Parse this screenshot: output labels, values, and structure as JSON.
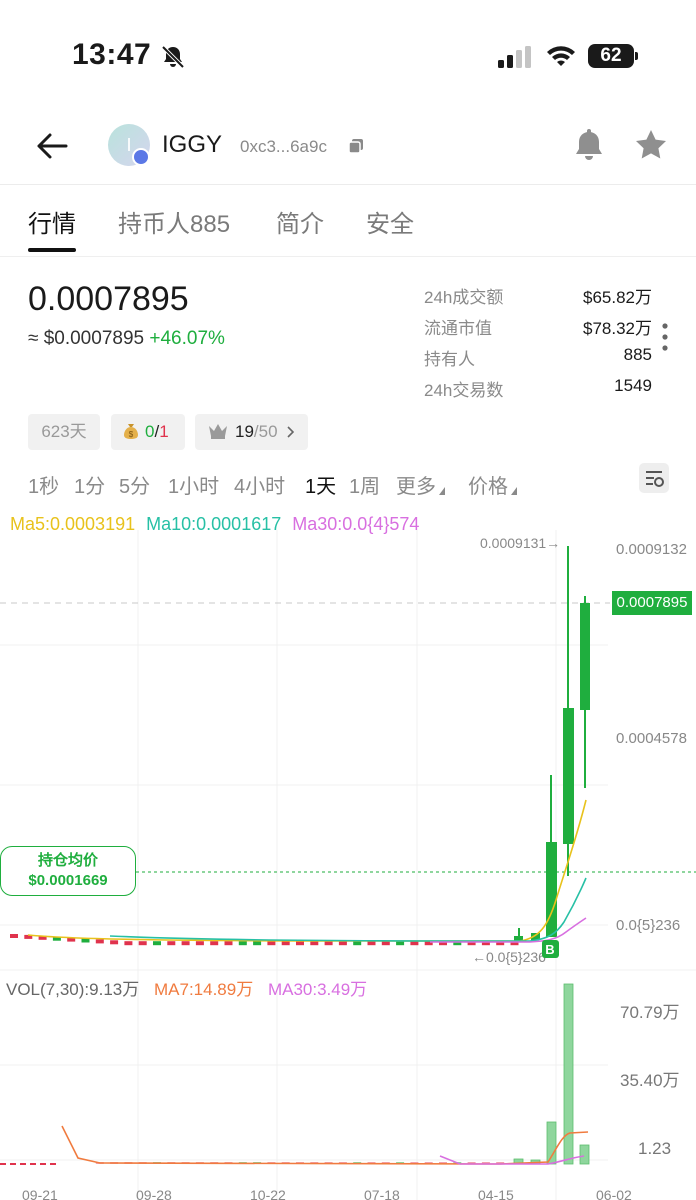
{
  "status_bar": {
    "time": "13:47",
    "battery": "62"
  },
  "header": {
    "token_symbol": "IGGY",
    "avatar_letter": "I",
    "address": "0xc3...6a9c"
  },
  "tabs": [
    {
      "label": "行情",
      "active": true
    },
    {
      "label": "持币人885",
      "active": false
    },
    {
      "label": "简介",
      "active": false
    },
    {
      "label": "安全",
      "active": false
    }
  ],
  "price": {
    "last": "0.0007895",
    "usd": "≈ $0.0007895",
    "change": "+46.07%"
  },
  "stats": [
    {
      "label": "24h成交额",
      "value": "$65.82万"
    },
    {
      "label": "流通市值",
      "value": "$78.32万"
    },
    {
      "label": "持有人",
      "value": "885"
    },
    {
      "label": "24h交易数",
      "value": "1549"
    }
  ],
  "chips": {
    "age": "623天",
    "bag_a": "0",
    "bag_sep": "/",
    "bag_b": "1",
    "top_a": "19",
    "top_b": "/50"
  },
  "intervals": [
    {
      "label": "1秒",
      "active": false
    },
    {
      "label": "1分",
      "active": false
    },
    {
      "label": "5分",
      "active": false
    },
    {
      "label": "1小时",
      "active": false
    },
    {
      "label": "4小时",
      "active": false
    },
    {
      "label": "1天",
      "active": true
    },
    {
      "label": "1周",
      "active": false
    },
    {
      "label": "更多",
      "active": false
    },
    {
      "label": "价格",
      "active": false
    }
  ],
  "ma_legend": {
    "ma5": "Ma5:0.0003191",
    "ma10": "Ma10:0.0001617",
    "ma30": "Ma30:0.0{4}574"
  },
  "hold_avg": {
    "label": "持仓均价",
    "value": "$0.0001669"
  },
  "current_price_tag": "0.0007895",
  "high_label": "0.0009131→",
  "low_label": "←0.0{5}236",
  "buy_marker": "B",
  "vol_legend": {
    "vol": "VOL(7,30):9.13万",
    "ma7": "MA7:14.89万",
    "ma30": "MA30:3.49万"
  },
  "colors": {
    "up": "#1fae3e",
    "down": "#e0334d",
    "ma5": "#e8c21c",
    "ma10": "#27c0a5",
    "ma30": "#d86fe0",
    "vol_ma7": "#f07b3f"
  },
  "chart_data": {
    "type": "candlestick",
    "price_axis_ticks": [
      "0.0009132",
      "0.0004578",
      "0.0{5}236"
    ],
    "volume_axis_ticks": [
      "70.79万",
      "35.40万",
      "1.23"
    ],
    "x_tick_labels": [
      "09-21",
      "09-28",
      "10-22",
      "07-18",
      "04-15",
      "06-02"
    ],
    "recent_candles": [
      {
        "open": 2.36e-06,
        "close": 2.36e-06,
        "high": 2.36e-06,
        "low": 2.36e-06
      },
      {
        "open": 4e-06,
        "close": 0.0001669,
        "high": 0.000345,
        "low": 3e-06
      },
      {
        "open": 0.0001669,
        "close": 0.000538,
        "high": 0.0009131,
        "low": 0.000145
      },
      {
        "open": 0.000538,
        "close": 0.0007895,
        "high": 0.000797,
        "low": 0.00033
      }
    ],
    "volume_recent": [
      "1.23",
      "35.40万",
      "70.79万",
      "9.13万"
    ]
  }
}
